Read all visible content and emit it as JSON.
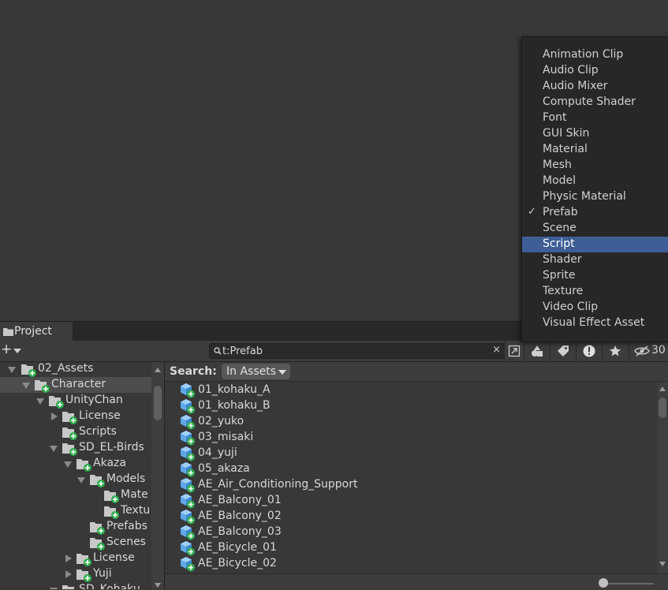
{
  "window": {
    "tab_label": "Project"
  },
  "toolbar": {
    "add_label": "+",
    "search_value": "t:Prefab",
    "clear_label": "×",
    "hidden_count": "30"
  },
  "tree": {
    "rows": [
      {
        "label": "02_Assets",
        "expanded": true
      },
      {
        "label": "Character",
        "expanded": true,
        "selected": true
      },
      {
        "label": "UnityChan",
        "expanded": true
      },
      {
        "label": "License",
        "expanded": false
      },
      {
        "label": "Scripts"
      },
      {
        "label": "SD_EL-Birds",
        "expanded": true
      },
      {
        "label": "Akaza",
        "expanded": true
      },
      {
        "label": "Models",
        "expanded": true
      },
      {
        "label": "Mate"
      },
      {
        "label": "Textu"
      },
      {
        "label": "Prefabs"
      },
      {
        "label": "Scenes"
      },
      {
        "label": "License",
        "expanded": false
      },
      {
        "label": "Yuji",
        "expanded": false
      },
      {
        "label": "SD_Kohaku",
        "expanded": true
      }
    ]
  },
  "searchbar": {
    "label": "Search:",
    "scope": "In Assets"
  },
  "results": [
    "01_kohaku_A",
    "01_kohaku_B",
    "02_yuko",
    "03_misaki",
    "04_yuji",
    "05_akaza",
    "AE_Air_Conditioning_Support",
    "AE_Balcony_01",
    "AE_Balcony_02",
    "AE_Balcony_03",
    "AE_Bicycle_01",
    "AE_Bicycle_02"
  ],
  "type_menu": {
    "items": [
      {
        "label": "Animation Clip"
      },
      {
        "label": "Audio Clip"
      },
      {
        "label": "Audio Mixer"
      },
      {
        "label": "Compute Shader"
      },
      {
        "label": "Font"
      },
      {
        "label": "GUI Skin"
      },
      {
        "label": "Material"
      },
      {
        "label": "Mesh"
      },
      {
        "label": "Model"
      },
      {
        "label": "Physic Material"
      },
      {
        "label": "Prefab",
        "checked": true,
        "check_mark": "✓"
      },
      {
        "label": "Scene"
      },
      {
        "label": "Script",
        "highlighted": true
      },
      {
        "label": "Shader"
      },
      {
        "label": "Sprite"
      },
      {
        "label": "Texture"
      },
      {
        "label": "Video Clip"
      },
      {
        "label": "Visual Effect Asset"
      }
    ]
  },
  "icons": {
    "folder": "folder-icon",
    "prefab": "prefab-cube-icon",
    "add_badge": "green-plus-badge"
  },
  "colors": {
    "highlight": "#3e5e96",
    "badge": "#2fae4e",
    "prefab": "#5fa8e8"
  }
}
